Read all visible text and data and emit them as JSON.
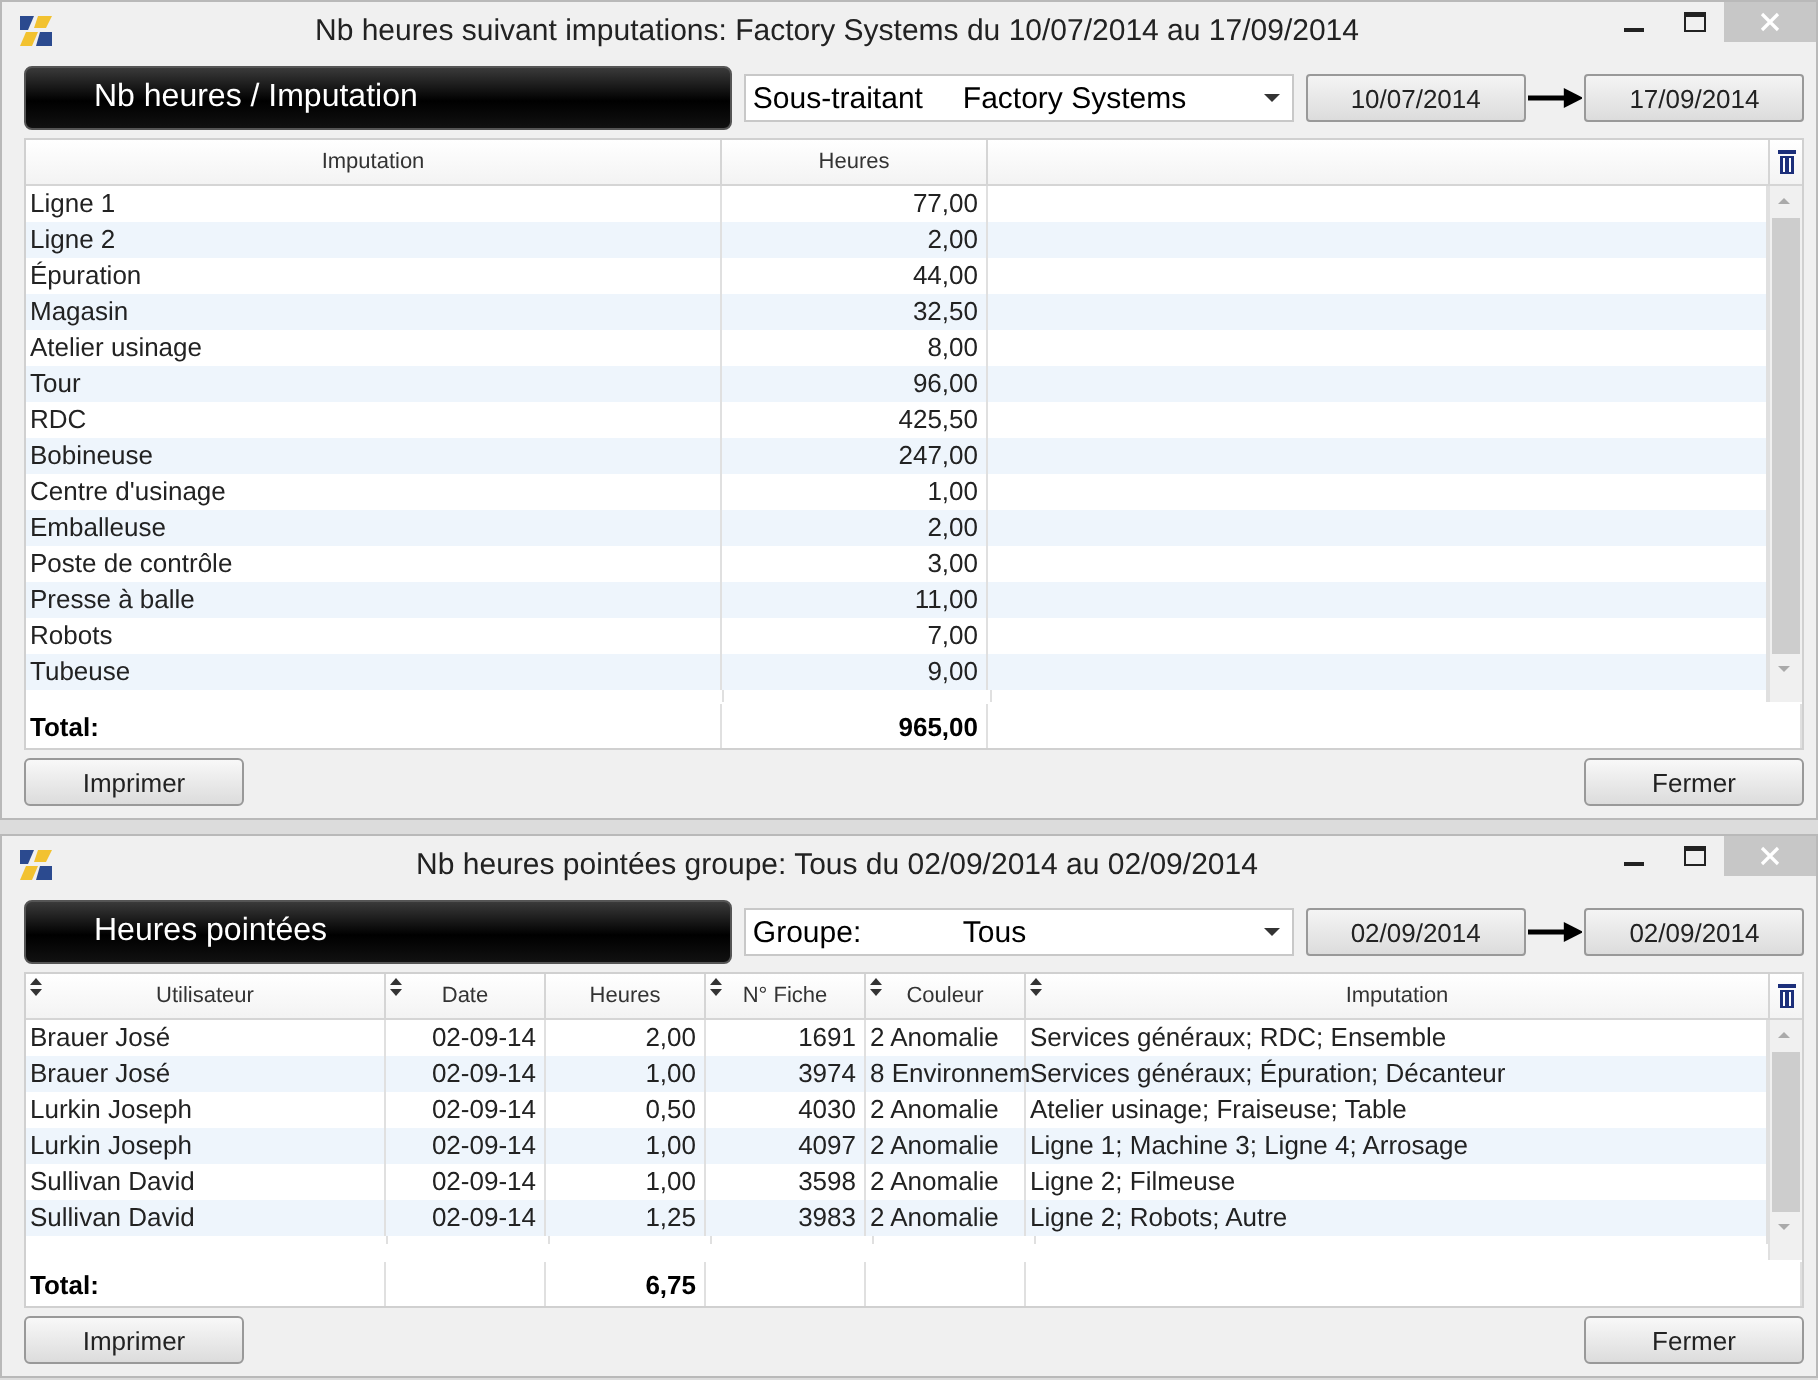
{
  "windows": [
    {
      "title": "Nb heures suivant imputations: Factory Systems du 10/07/2014 au 17/09/2014",
      "header": "Nb heures / Imputation",
      "filter": {
        "label": "Sous-traitant",
        "value": "Factory Systems"
      },
      "date_from": "10/07/2014",
      "date_to": "17/09/2014",
      "columns": [
        {
          "label": "Imputation",
          "sortable": false
        },
        {
          "label": "Heures",
          "sortable": false
        }
      ],
      "rows": [
        [
          "Ligne 1",
          "77,00"
        ],
        [
          "Ligne 2",
          "2,00"
        ],
        [
          "Épuration",
          "44,00"
        ],
        [
          "Magasin",
          "32,50"
        ],
        [
          "Atelier usinage",
          "8,00"
        ],
        [
          "Tour",
          "96,00"
        ],
        [
          "RDC",
          "425,50"
        ],
        [
          "Bobineuse",
          "247,00"
        ],
        [
          "Centre d'usinage",
          "1,00"
        ],
        [
          "Emballeuse",
          "2,00"
        ],
        [
          "Poste de contrôle",
          "3,00"
        ],
        [
          "Presse à balle",
          "11,00"
        ],
        [
          "Robots",
          "7,00"
        ],
        [
          "Tubeuse",
          "9,00"
        ]
      ],
      "total_label": "Total:",
      "total": "965,00",
      "buttons": [
        "Imprimer",
        "Fermer"
      ]
    },
    {
      "title": "Nb heures pointées groupe: Tous du 02/09/2014 au 02/09/2014",
      "header": "Heures pointées",
      "filter": {
        "label": "Groupe:",
        "value": "Tous"
      },
      "date_from": "02/09/2014",
      "date_to": "02/09/2014",
      "columns": [
        {
          "label": "Utilisateur",
          "sortable": true
        },
        {
          "label": "Date",
          "sortable": true
        },
        {
          "label": "Heures",
          "sortable": false
        },
        {
          "label": "N° Fiche",
          "sortable": true
        },
        {
          "label": "Couleur",
          "sortable": true
        },
        {
          "label": "Imputation",
          "sortable": true
        }
      ],
      "rows": [
        [
          "Brauer José",
          "02-09-14",
          "2,00",
          "1691",
          "2 Anomalie",
          "Services généraux; RDC; Ensemble"
        ],
        [
          "Brauer José",
          "02-09-14",
          "1,00",
          "3974",
          "8 Environnem",
          "Services généraux; Épuration; Décanteur"
        ],
        [
          "Lurkin Joseph",
          "02-09-14",
          "0,50",
          "4030",
          "2 Anomalie",
          "Atelier usinage; Fraiseuse; Table"
        ],
        [
          "Lurkin Joseph",
          "02-09-14",
          "1,00",
          "4097",
          "2 Anomalie",
          "Ligne 1; Machine 3; Ligne 4; Arrosage"
        ],
        [
          "Sullivan David",
          "02-09-14",
          "1,00",
          "3598",
          "2 Anomalie",
          "Ligne 2; Filmeuse"
        ],
        [
          "Sullivan David",
          "02-09-14",
          "1,25",
          "3983",
          "2 Anomalie",
          "Ligne 2; Robots; Autre"
        ]
      ],
      "total_label": "Total:",
      "total": "6,75",
      "buttons": [
        "Imprimer",
        "Fermer"
      ]
    }
  ]
}
